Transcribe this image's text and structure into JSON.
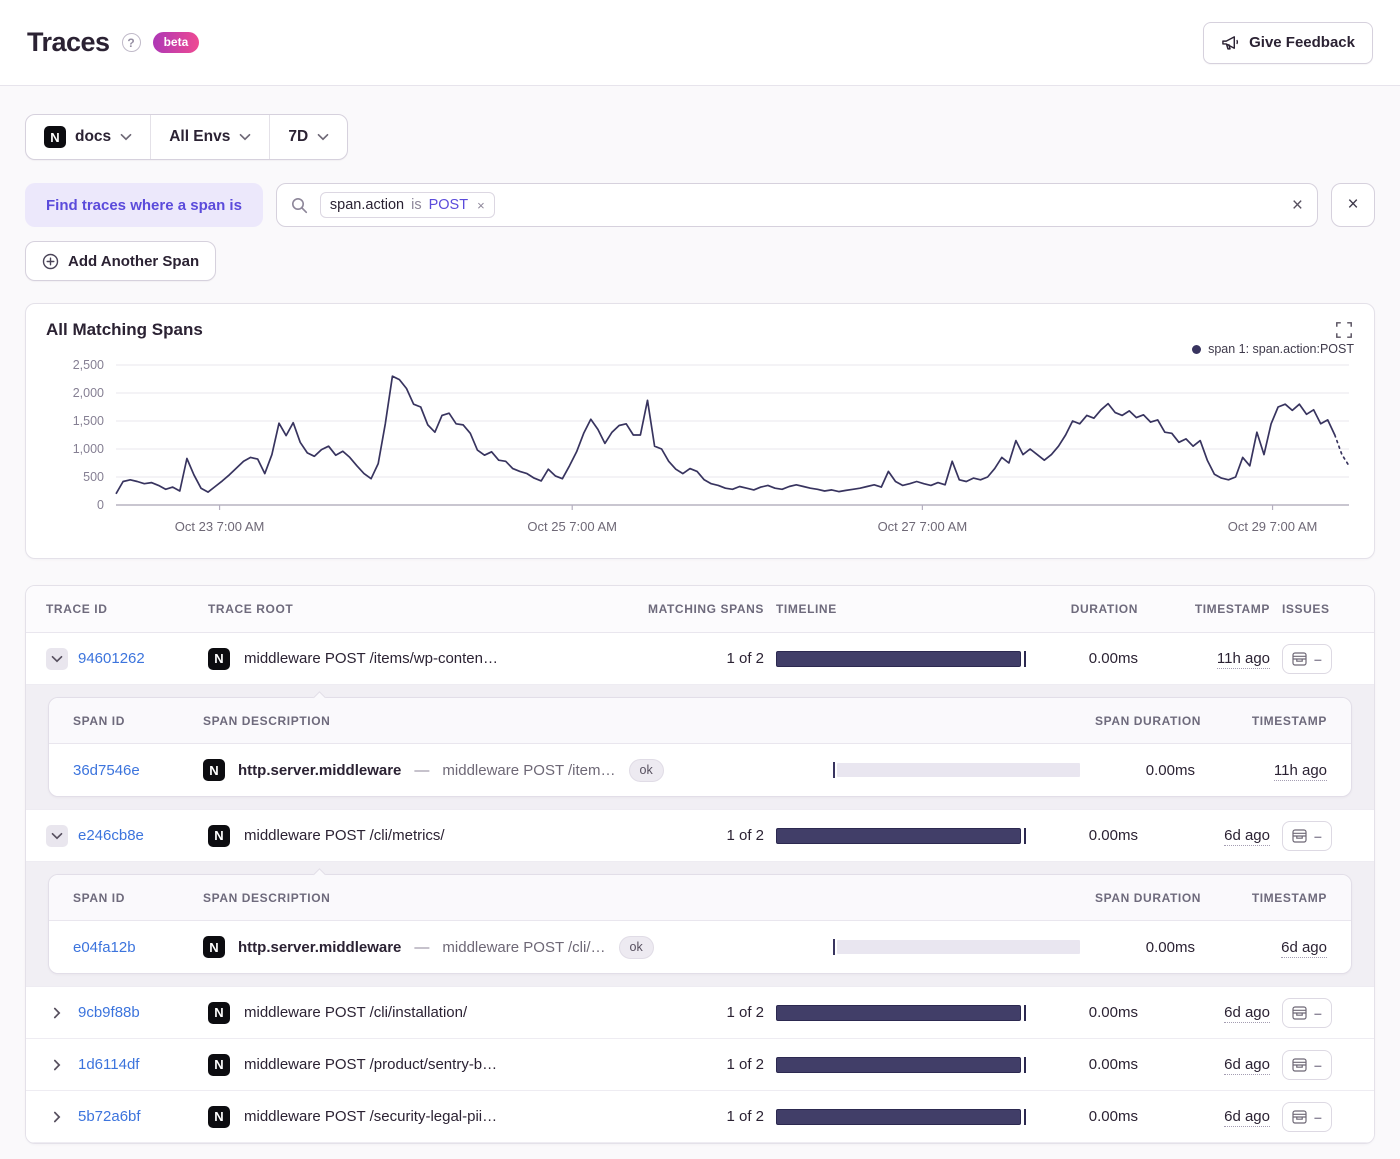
{
  "header": {
    "title": "Traces",
    "beta_label": "beta",
    "feedback_label": "Give Feedback"
  },
  "filters": {
    "project": "docs",
    "environment": "All Envs",
    "period": "7D"
  },
  "span_search": {
    "label": "Find traces where a span is",
    "token_key": "span.action",
    "token_op": "is",
    "token_value": "POST",
    "add_button": "Add Another Span"
  },
  "chart_data": {
    "type": "line",
    "title": "All Matching Spans",
    "legend": "span 1: span.action:POST",
    "legend_position": "top-right",
    "ylim": [
      0,
      2500
    ],
    "grid": true,
    "y_tick_labels": [
      "0",
      "500",
      "1,000",
      "1,500",
      "2,000",
      "2,500"
    ],
    "y_tick_values": [
      0,
      500,
      1000,
      1500,
      2000,
      2500
    ],
    "x_tick_labels": [
      "Oct 23 7:00 AM",
      "Oct 25 7:00 AM",
      "Oct 27 7:00 AM",
      "Oct 29 7:00 AM"
    ],
    "x_tick_fractions": [
      0.084,
      0.37,
      0.654,
      0.938
    ],
    "line_color": "#38345f",
    "dashed_tail_points": 2,
    "values": [
      200,
      420,
      450,
      420,
      380,
      400,
      350,
      280,
      320,
      250,
      830,
      540,
      300,
      230,
      330,
      430,
      540,
      660,
      780,
      850,
      820,
      560,
      900,
      1460,
      1240,
      1470,
      1120,
      930,
      870,
      990,
      1050,
      890,
      960,
      850,
      700,
      560,
      470,
      740,
      1450,
      2300,
      2240,
      2080,
      1800,
      1750,
      1430,
      1300,
      1600,
      1640,
      1450,
      1430,
      1280,
      980,
      890,
      950,
      800,
      780,
      650,
      600,
      560,
      480,
      430,
      640,
      520,
      470,
      700,
      950,
      1280,
      1530,
      1350,
      1100,
      1300,
      1420,
      1450,
      1250,
      1250,
      1870,
      1050,
      1000,
      780,
      640,
      560,
      650,
      600,
      450,
      380,
      350,
      300,
      280,
      330,
      300,
      270,
      320,
      350,
      300,
      280,
      330,
      360,
      330,
      300,
      280,
      250,
      270,
      240,
      260,
      280,
      300,
      330,
      360,
      320,
      600,
      420,
      350,
      380,
      420,
      380,
      350,
      400,
      360,
      780,
      450,
      420,
      480,
      450,
      500,
      650,
      850,
      750,
      1150,
      900,
      1000,
      900,
      800,
      900,
      1050,
      1250,
      1500,
      1450,
      1600,
      1550,
      1700,
      1810,
      1650,
      1600,
      1680,
      1560,
      1610,
      1480,
      1520,
      1300,
      1280,
      1120,
      1180,
      1050,
      1150,
      800,
      550,
      480,
      450,
      500,
      850,
      700,
      1300,
      900,
      1450,
      1750,
      1800,
      1690,
      1800,
      1620,
      1700,
      1450,
      1520,
      1250,
      900,
      700
    ]
  },
  "table": {
    "columns": [
      "Trace ID",
      "Trace Root",
      "Matching Spans",
      "Timeline",
      "Duration",
      "Timestamp",
      "Issues"
    ],
    "span_columns": [
      "Span ID",
      "Span Description",
      "Span Duration",
      "Timestamp"
    ],
    "issues_dash": "–",
    "desc_separator": "—",
    "rows": [
      {
        "trace_id": "94601262",
        "root": "middleware POST /items/wp-conten…",
        "matching": "1 of 2",
        "duration": "0.00ms",
        "timestamp": "11h ago",
        "expanded": true,
        "spans": [
          {
            "span_id": "36d7546e",
            "op": "http.server.middleware",
            "description": "middleware POST /item…",
            "status": "ok",
            "duration": "0.00ms",
            "timestamp": "11h ago"
          }
        ]
      },
      {
        "trace_id": "e246cb8e",
        "root": "middleware POST /cli/metrics/",
        "matching": "1 of 2",
        "duration": "0.00ms",
        "timestamp": "6d ago",
        "expanded": true,
        "spans": [
          {
            "span_id": "e04fa12b",
            "op": "http.server.middleware",
            "description": "middleware POST /cli/…",
            "status": "ok",
            "duration": "0.00ms",
            "timestamp": "6d ago"
          }
        ]
      },
      {
        "trace_id": "9cb9f88b",
        "root": "middleware POST /cli/installation/",
        "matching": "1 of 2",
        "duration": "0.00ms",
        "timestamp": "6d ago",
        "expanded": false,
        "spans": []
      },
      {
        "trace_id": "1d6114df",
        "root": "middleware POST /product/sentry-b…",
        "matching": "1 of 2",
        "duration": "0.00ms",
        "timestamp": "6d ago",
        "expanded": false,
        "spans": []
      },
      {
        "trace_id": "5b72a6bf",
        "root": "middleware POST /security-legal-pii…",
        "matching": "1 of 2",
        "duration": "0.00ms",
        "timestamp": "6d ago",
        "expanded": false,
        "spans": []
      }
    ]
  },
  "colors": {
    "accent_purple": "#5b4bdb",
    "accent_purple_bg": "#ece8fb",
    "link_blue": "#3c74dd",
    "chart_line": "#38345f",
    "timeline_bar": "#413e68",
    "span_bar_light": "#e9e6f0",
    "beta_gradient_start": "#ad37b6",
    "beta_gradient_end": "#ef4a92",
    "text_dark": "#2b2233",
    "text_gray": "#6e6a7c"
  }
}
